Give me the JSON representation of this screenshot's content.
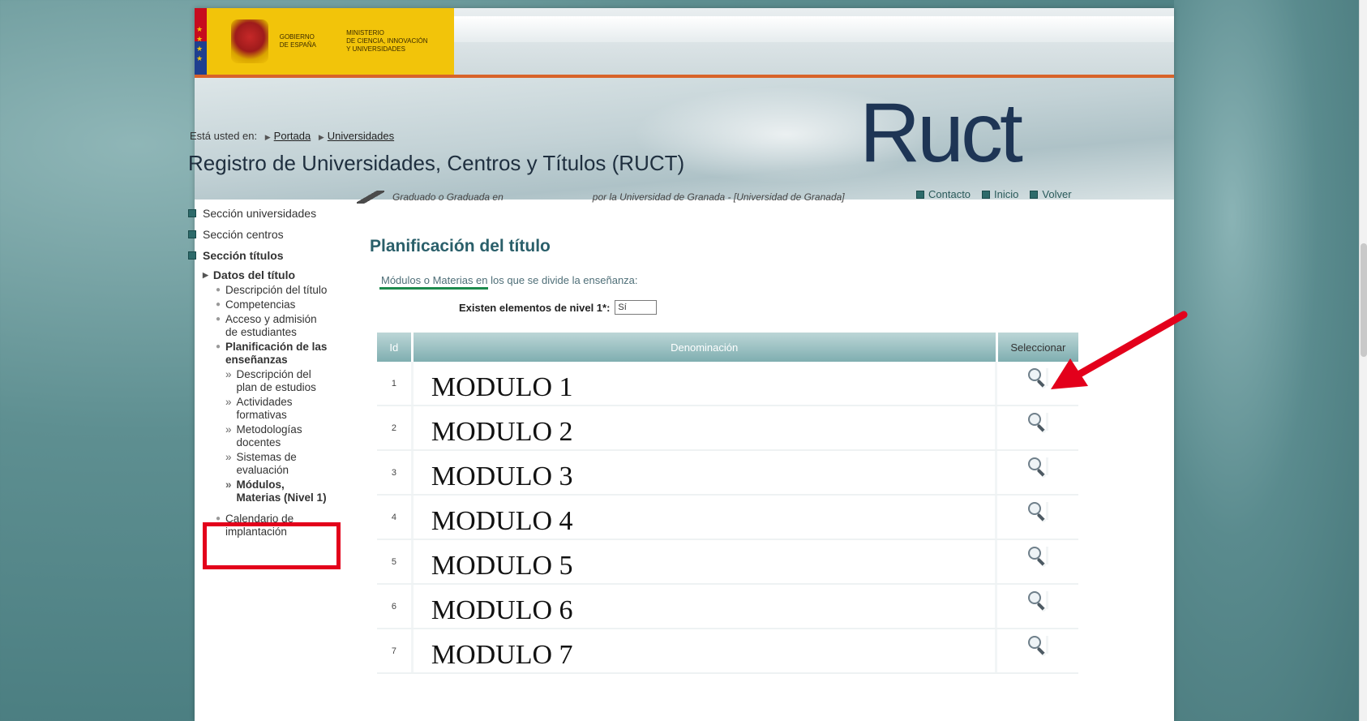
{
  "header": {
    "gov_line1": "GOBIERNO",
    "gov_line2": "DE ESPAÑA",
    "ministry_line1": "MINISTERIO",
    "ministry_line2": "DE CIENCIA, INNOVACIÓN",
    "ministry_line3": "Y UNIVERSIDADES",
    "logo_text": "Ruct",
    "accent_color": "#d8632a"
  },
  "breadcrumb": {
    "prefix": "Está usted en:",
    "items": [
      "Portada",
      "Universidades"
    ]
  },
  "site_title": "Registro de Universidades, Centros y Títulos (RUCT)",
  "sidebar": {
    "sections": [
      "Sección universidades",
      "Sección centros",
      "Sección títulos"
    ],
    "sub": "Datos del título",
    "items": [
      "Descripción del título",
      "Competencias",
      "Acceso y admisión de estudiantes",
      "Planificación de las enseñanzas"
    ],
    "subitems": [
      "Descripción del plan de estudios",
      "Actividades formativas",
      "Metodologías docentes",
      "Sistemas de evaluación",
      "Módulos, Materias (Nivel 1)"
    ],
    "last_item": "Calendario de implantación"
  },
  "info": {
    "degree_prefix": "Graduado o Graduada en",
    "university_text": "por la Universidad de Granada - [Universidad de Granada]"
  },
  "toplinks": [
    "Contacto",
    "Inicio",
    "Volver"
  ],
  "main": {
    "section_title": "Planificación del título",
    "sub_label": "Módulos o Materias en los que se divide la enseñanza:",
    "nivel_label": "Existen elementos de nivel 1*:",
    "nivel_value": "Sí"
  },
  "table": {
    "headers": [
      "Id",
      "Denominación",
      "Seleccionar"
    ],
    "rows": [
      {
        "id": "1",
        "name": "MODULO 1"
      },
      {
        "id": "2",
        "name": "MODULO 2"
      },
      {
        "id": "3",
        "name": "MODULO 3"
      },
      {
        "id": "4",
        "name": "MODULO 4"
      },
      {
        "id": "5",
        "name": "MODULO 5"
      },
      {
        "id": "6",
        "name": "MODULO 6"
      },
      {
        "id": "7",
        "name": "MODULO 7"
      }
    ]
  },
  "annotations": {
    "highlight_color": "#e3001b",
    "arrow_color": "#e3001b"
  }
}
